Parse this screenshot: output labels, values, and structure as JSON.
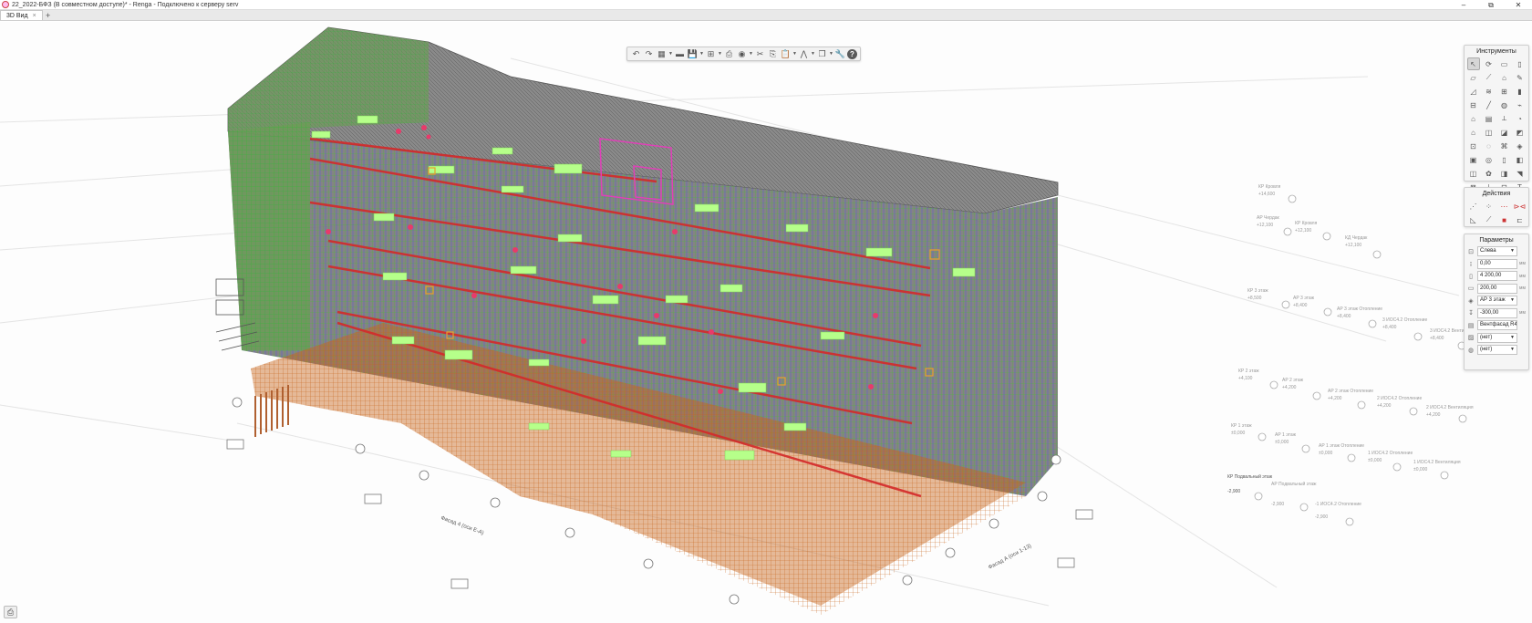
{
  "titlebar": {
    "title": "22_2022-БФЗ (В совместном доступе)* - Renga - Подключено к серверу serv",
    "minimize": "–",
    "restore": "⧉",
    "close": "✕"
  },
  "tabs": [
    {
      "label": "3D Вид",
      "close": "×"
    }
  ],
  "tab_add": "+",
  "toolbar": {
    "undo": "↶",
    "redo": "↷",
    "view": "▦",
    "layers": "▬",
    "save": "💾",
    "align": "⊞",
    "print": "⎙",
    "camera": "◉",
    "cut": "✂",
    "copy": "⎘",
    "paste": "📋",
    "terrain": "⋀",
    "cube": "❒",
    "settings": "🔧",
    "help": "?",
    "dropdown": "▼"
  },
  "tools_panel": {
    "title": "Инструменты",
    "icons": [
      "select-icon",
      "rotate-icon",
      "wall-icon",
      "column-icon",
      "slab-icon",
      "beam-icon",
      "roof-icon",
      "pencil-icon",
      "ramp-icon",
      "stair-icon",
      "window-icon",
      "door-icon",
      "railing-icon",
      "line-icon",
      "axis-icon",
      "pipe-icon",
      "room-icon",
      "table-icon",
      "dimension-icon",
      "fitting-icon",
      "house-icon",
      "device-icon",
      "duct-icon",
      "equipment-icon",
      "level-icon",
      "opening-icon",
      "rebar-icon",
      "route-icon",
      "element-icon",
      "section-icon",
      "hydrant-icon",
      "tag-icon",
      "panel-icon",
      "gear-icon",
      "insert-icon",
      "light-icon",
      "grid-icon",
      "link-icon",
      "group-icon",
      "text-icon"
    ],
    "glyphs": [
      "↖",
      "⟳",
      "▭",
      "▯",
      "▱",
      "⟋",
      "⌂",
      "✎",
      "◿",
      "≋",
      "⊞",
      "▮",
      "⊟",
      "╱",
      "◍",
      "⌁",
      "⌂",
      "▤",
      "⟂",
      "◔",
      "⌂",
      "◫",
      "◪",
      "◩",
      "⊡",
      "◌",
      "⌘",
      "◈",
      "▣",
      "◎",
      "▯",
      "◧",
      "◫",
      "✿",
      "◨",
      "◥",
      "⊠",
      "⟂",
      "⊡",
      "T"
    ]
  },
  "actions_panel": {
    "title": "Действия",
    "glyphs": [
      "⋰",
      "⁘",
      "⋯",
      "⊳⊲",
      "◺",
      "⟋",
      "■",
      "⊏"
    ]
  },
  "params_panel": {
    "title": "Параметры",
    "rows": [
      {
        "icon": "⊡",
        "value": "Слева",
        "dropdown": "▼",
        "unit": ""
      },
      {
        "icon": "↨",
        "value": "0,00",
        "dropdown": "",
        "unit": "мм"
      },
      {
        "icon": "▯",
        "value": "4 200,00",
        "dropdown": "",
        "unit": "мм"
      },
      {
        "icon": "▭",
        "value": "200,00",
        "dropdown": "",
        "unit": "мм"
      },
      {
        "icon": "◈",
        "value": "АР 3 этаж",
        "dropdown": "▼",
        "unit": ""
      },
      {
        "icon": "↧",
        "value": "-300,00",
        "dropdown": "",
        "unit": "мм"
      },
      {
        "icon": "▤",
        "value": "Вентфасад R4",
        "dropdown": "▼",
        "unit": ""
      },
      {
        "icon": "▨",
        "value": "(нет)",
        "dropdown": "▼",
        "unit": ""
      },
      {
        "icon": "◍",
        "value": "(нет)",
        "dropdown": "▼",
        "unit": ""
      }
    ]
  },
  "print_button": "⎙",
  "levels": [
    {
      "name": "КР Кровля",
      "elev": "+14,600"
    },
    {
      "name": "АР Чердак",
      "elev": "+12,100"
    },
    {
      "name": "КР Кровля",
      "elev": "+12,100"
    },
    {
      "name": "КД Чердак",
      "elev": "+12,100"
    },
    {
      "name": "КР 3 этаж",
      "elev": "+8,500"
    },
    {
      "name": "АР 3 этаж",
      "elev": "+8,400"
    },
    {
      "name": "АР 3 этаж Отопление",
      "elev": "+8,400"
    },
    {
      "name": "3 ИОС4.2 Отопление",
      "elev": "+8,400"
    },
    {
      "name": "3 ИОС4.2 Вентиляция",
      "elev": "+8,400"
    },
    {
      "name": "КР 2 этаж",
      "elev": "+4,100"
    },
    {
      "name": "АР 2 этаж",
      "elev": "+4,200"
    },
    {
      "name": "АР 2 этаж Отопление",
      "elev": "+4,200"
    },
    {
      "name": "2 ИОС4.2 Отопление",
      "elev": "+4,200"
    },
    {
      "name": "2 ИОС4.2 Вентиляция",
      "elev": "+4,200"
    },
    {
      "name": "КР 1 этаж",
      "elev": "±0,000"
    },
    {
      "name": "АР 1 этаж",
      "elev": "±0,000"
    },
    {
      "name": "АР 1 этаж Отопление",
      "elev": "±0,000"
    },
    {
      "name": "1 ИОС4.2 Отопление",
      "elev": "±0,000"
    },
    {
      "name": "1 ИОС4.2 Вентиляция",
      "elev": "±0,000"
    },
    {
      "name": "КР Подвальный этаж",
      "elev": "-2,900"
    },
    {
      "name": "АР Подвальный этаж",
      "elev": "-2,900"
    },
    {
      "name": "-1 ИОС4.2 Отопление",
      "elev": "-2,900"
    }
  ],
  "grid_axes": [
    "1",
    "2",
    "3",
    "4",
    "5",
    "6",
    "7",
    "8",
    "9",
    "10",
    "11",
    "12",
    "13",
    "А",
    "Б",
    "В",
    "Г",
    "Д",
    "Е"
  ],
  "facade_labels": [
    "Фасад 4 (оси Е-А)",
    "Фасад А (оси 1-13)"
  ],
  "colors": {
    "steel": "#6b6b6b",
    "orange": "#c8651d",
    "green": "#4aa63c",
    "blue": "#4a4ad8",
    "lime": "#b6ff8a",
    "magenta": "#e040b8",
    "red": "#d42a2a"
  }
}
